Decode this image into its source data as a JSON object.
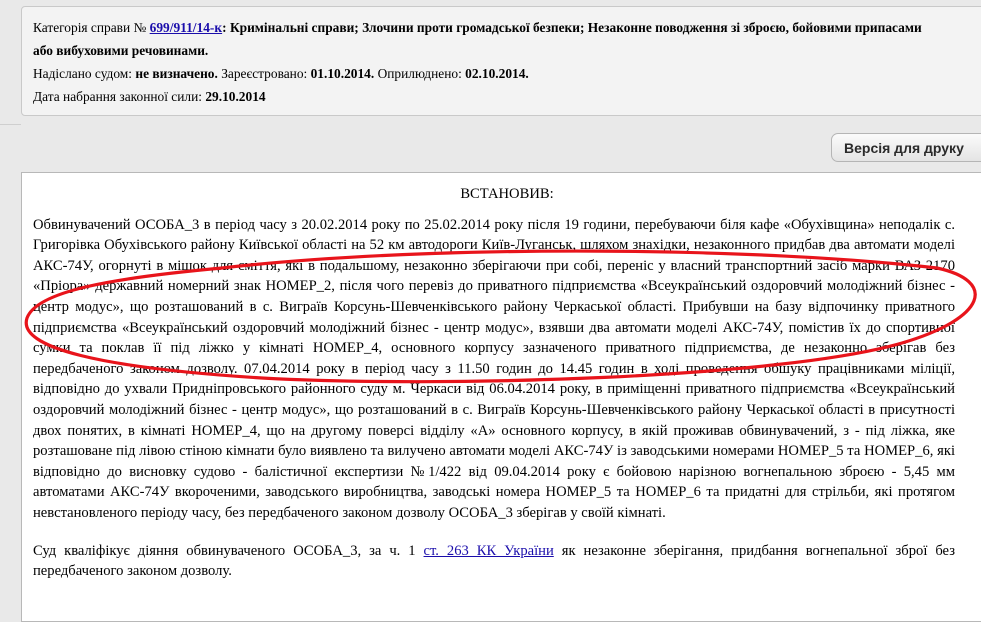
{
  "case_info": {
    "category_label": "Категорія справи №",
    "case_number": "699/911/14-к",
    "category_path": "Кримінальні справи; Злочини проти громадської безпеки; Незаконне поводження зі зброєю, бойовими припасами",
    "category_path_cont": "або вибуховими речовинами.",
    "sent_by_court_label": "Надіслано судом:",
    "sent_by_court_value": "не визначено.",
    "registered_label": "Зареєстровано:",
    "registered_value": "01.10.2014.",
    "published_label": "Оприлюднено:",
    "published_value": "02.10.2014.",
    "effective_label": "Дата набрання законної сили:",
    "effective_value": "29.10.2014"
  },
  "toolbar": {
    "print_label": "Версія для друку"
  },
  "document": {
    "heading": "ВСТАНОВИВ:",
    "paragraph1": "Обвинувачений ОСОБА_3 в період часу з 20.02.2014 року по 25.02.2014 року  після 19 години, перебуваючи біля кафе «Обухівщина» неподалік с. Григорівка Обухівського району Київської області на 52 км автодороги Київ-Луганськ, шляхом знахідки, незаконного придбав два автомати моделі АКС-74У, огорнуті в мішок для сміття, які в подальшому, незаконно зберігаючи при собі, переніс у власний транспортний засіб марки ВАЗ 2170 «Пріора» державний номерний знак НОМЕР_2, після чого перевіз до приватного підприємства «Всеукраїнський оздоровчий молодіжний бізнес  - центр модус», що розташований в с. Виграїв Корсунь-Шевченківського району Черкаської області. Прибувши на базу відпочинку приватного підприємства «Всеукраїнський оздоровчий молодіжний бізнес  - центр модус», взявши два автомати моделі АКС-74У, помістив їх до спортивної сумки та поклав її під ліжко у кімнаті НОМЕР_4, основного корпусу зазначеного приватного підприємства, де незаконно зберігав без передбаченого законом дозволу. 07.04.2014 року в період часу з 11.50 годин до 14.45 годин в ході проведення обшуку працівниками міліції, відповідно до ухвали Придніпровського районного суду м. Черкаси від 06.04.2014 року, в приміщенні приватного підприємства «Всеукраїнський оздоровчий молодіжний бізнес  - центр модус»,  що розташований в с. Виграїв Корсунь-Шевченківського району Черкаської області  в присутності двох понятих, в кімнаті НОМЕР_4, що на другому поверсі відділу «А» основного корпусу, в якій проживав обвинувачений, з - під ліжка, яке розташоване під лівою стіною кімнати було виявлено та вилучено  автомати моделі АКС-74У із заводськими номерами НОМЕР_5 та НОМЕР_6, які відповідно до висновку судово - балістичної експертизи №1/422 від 09.04.2014 року є бойовою нарізною вогнепальною зброєю - 5,45 мм автоматами АКС-74У вкороченими, заводського виробництва, заводські номера НОМЕР_5 та НОМЕР_6 та придатні для стрільби, які протягом невстановленого періоду часу, без передбаченого законом дозволу ОСОБА_3 зберігав у своїй кімнаті.",
    "paragraph2_start": "Суд кваліфікує діяння обвинуваченого ОСОБА_3, за ч. 1 ",
    "paragraph2_link": "ст. 263 КК України",
    "paragraph2_end": " як незаконне зберігання, придбання вогнепальної зброї без передбаченого законом дозволу."
  },
  "colors": {
    "annotation_ellipse": "#e8141b",
    "link": "#1a0dab"
  },
  "icons": [
    "scroll-up-icon",
    "scroll-down-icon",
    "scroll-grip-icon"
  ]
}
